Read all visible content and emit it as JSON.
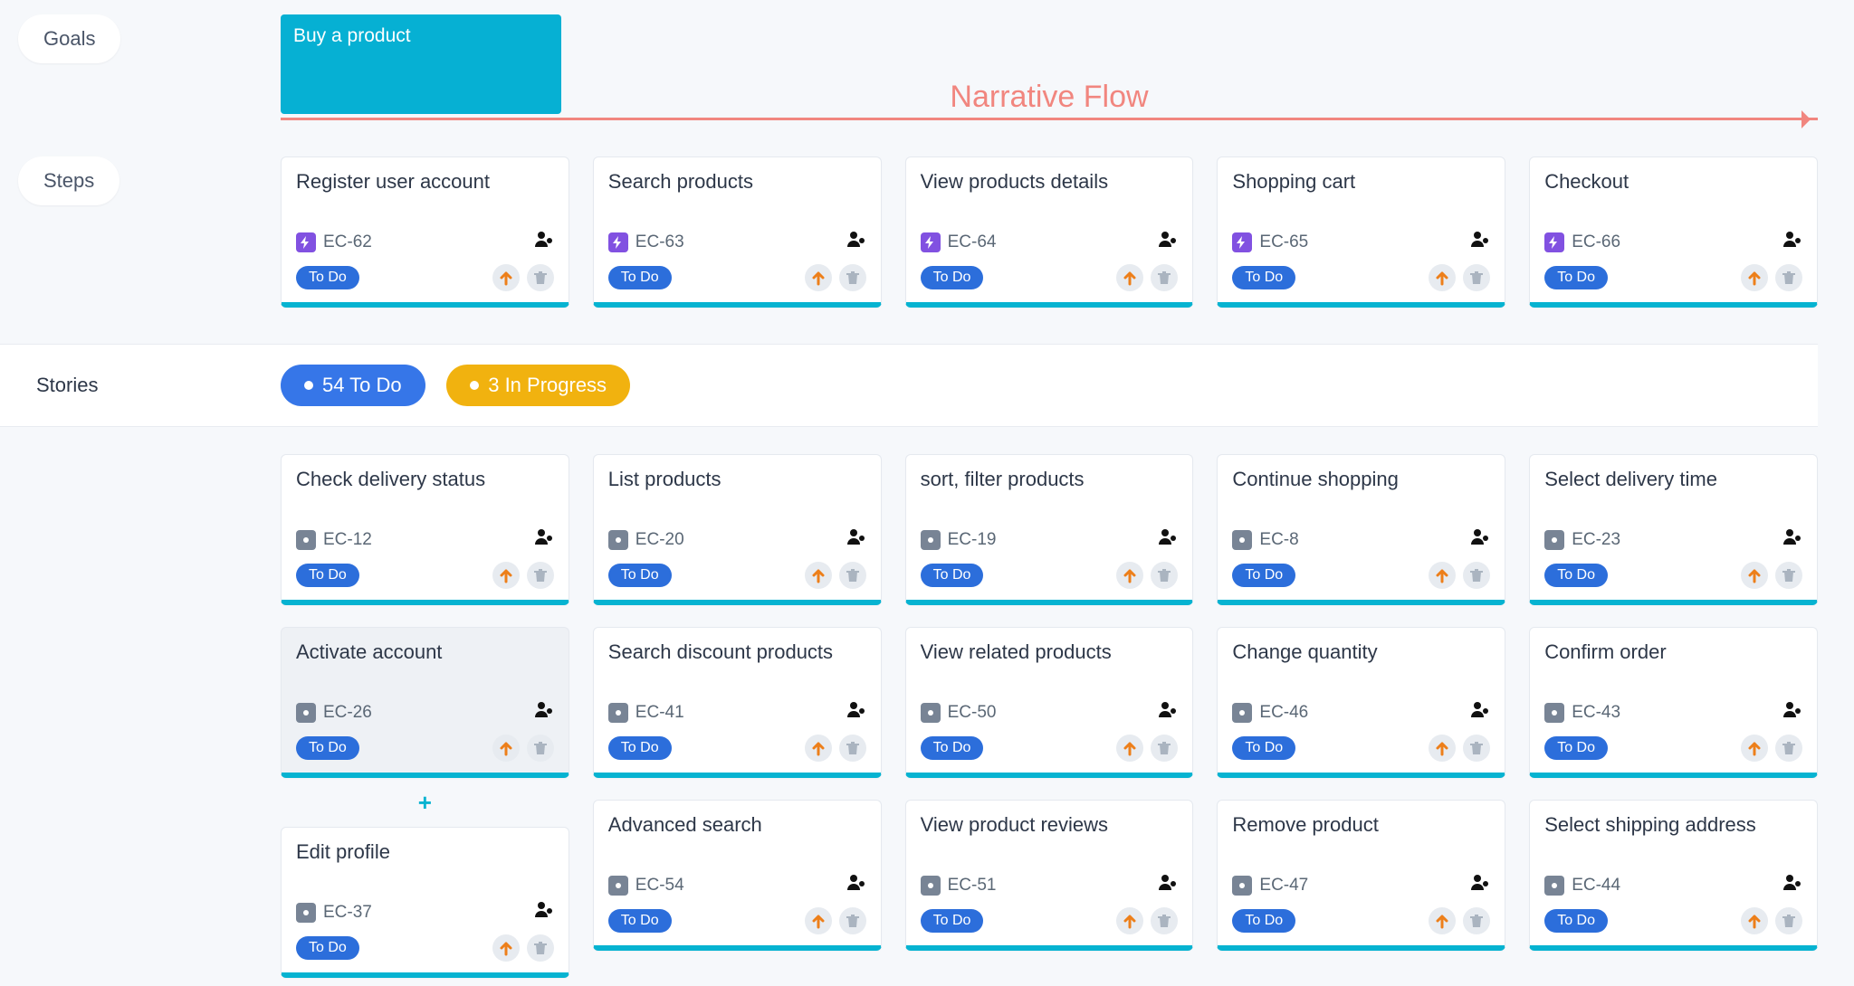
{
  "labels": {
    "goals": "Goals",
    "steps": "Steps",
    "stories": "Stories",
    "narrative_flow": "Narrative Flow",
    "add_glyph": "+"
  },
  "goal": {
    "title": "Buy a product"
  },
  "counts": {
    "todo": {
      "text": "54 To Do"
    },
    "progress": {
      "text": "3 In Progress"
    }
  },
  "status_todo": "To Do",
  "steps": [
    {
      "title": "Register user account",
      "key": "EC-62"
    },
    {
      "title": "Search products",
      "key": "EC-63"
    },
    {
      "title": "View products details",
      "key": "EC-64"
    },
    {
      "title": "Shopping cart",
      "key": "EC-65"
    },
    {
      "title": "Checkout",
      "key": "EC-66"
    }
  ],
  "stories": [
    [
      {
        "title": "Check delivery status",
        "key": "EC-12"
      },
      {
        "title": "Activate account",
        "key": "EC-26",
        "selected": true
      },
      {
        "title": "Edit profile",
        "key": "EC-37"
      }
    ],
    [
      {
        "title": "List products",
        "key": "EC-20"
      },
      {
        "title": "Search discount products",
        "key": "EC-41"
      },
      {
        "title": "Advanced search",
        "key": "EC-54"
      }
    ],
    [
      {
        "title": "sort, filter products",
        "key": "EC-19"
      },
      {
        "title": "View related products",
        "key": "EC-50"
      },
      {
        "title": "View product reviews",
        "key": "EC-51"
      }
    ],
    [
      {
        "title": "Continue shopping",
        "key": "EC-8"
      },
      {
        "title": "Change quantity",
        "key": "EC-46"
      },
      {
        "title": "Remove product",
        "key": "EC-47"
      }
    ],
    [
      {
        "title": "Select delivery time",
        "key": "EC-23"
      },
      {
        "title": "Confirm order",
        "key": "EC-43"
      },
      {
        "title": "Select shipping address",
        "key": "EC-44"
      }
    ]
  ]
}
